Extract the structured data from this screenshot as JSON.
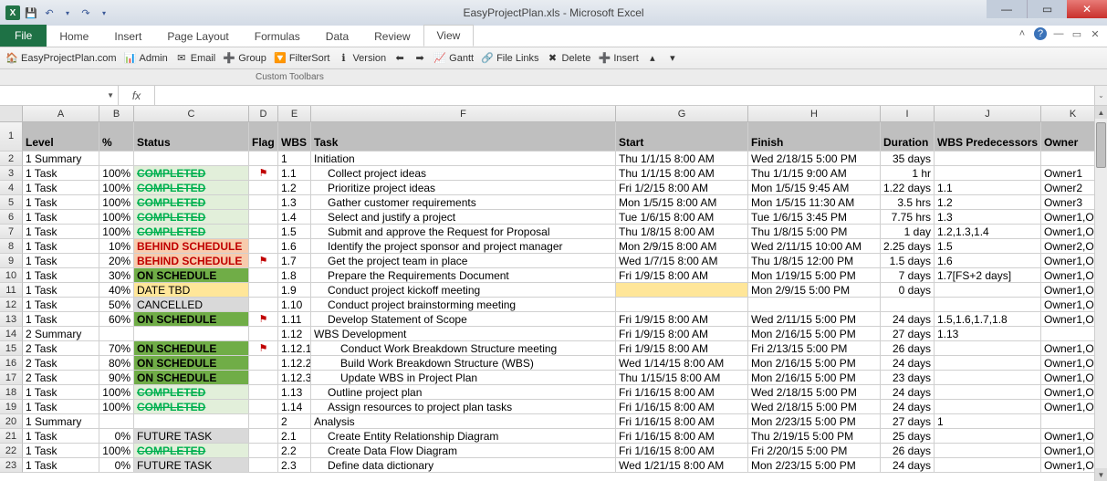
{
  "window": {
    "title": "EasyProjectPlan.xls   -  Microsoft Excel",
    "qat": {
      "undo": "↶",
      "redo": "↷",
      "dropdown": "▾"
    }
  },
  "ribbon": {
    "tabs": [
      "File",
      "Home",
      "Insert",
      "Page Layout",
      "Formulas",
      "Data",
      "Review",
      "View"
    ],
    "help_tip": "?"
  },
  "toolbar": {
    "items": [
      {
        "icon": "🏠",
        "label": "EasyProjectPlan.com"
      },
      {
        "icon": "📊",
        "label": "Admin"
      },
      {
        "icon": "✉",
        "label": "Email"
      },
      {
        "icon": "➕",
        "label": "Group"
      },
      {
        "icon": "🔽",
        "label": "FilterSort"
      },
      {
        "icon": "ℹ",
        "label": "Version"
      },
      {
        "icon": "⬅",
        "label": ""
      },
      {
        "icon": "➡",
        "label": ""
      },
      {
        "icon": "📈",
        "label": "Gantt"
      },
      {
        "icon": "🔗",
        "label": "File Links"
      },
      {
        "icon": "✖",
        "label": "Delete"
      },
      {
        "icon": "➕",
        "label": "Insert"
      },
      {
        "icon": "▴",
        "label": ""
      },
      {
        "icon": "▾",
        "label": ""
      }
    ],
    "group_label": "Custom Toolbars"
  },
  "formula_bar": {
    "name_box": "",
    "fx": "fx",
    "value": ""
  },
  "columns": [
    "",
    "A",
    "B",
    "C",
    "D",
    "E",
    "F",
    "G",
    "H",
    "I",
    "J",
    "K"
  ],
  "headers": {
    "level": "Level",
    "pct": "%",
    "status": "Status",
    "flag": "Flag",
    "wbs": "WBS",
    "task": "Task",
    "start": "Start",
    "finish": "Finish",
    "duration": "Duration",
    "pred": "WBS Predecessors",
    "owner": "Owner"
  },
  "rows": [
    {
      "n": 2,
      "type": "sum1",
      "level": "1 Summary",
      "pct": "",
      "status": "",
      "flag": "",
      "wbs": "1",
      "task": "Initiation",
      "start": "Thu 1/1/15 8:00 AM",
      "finish": "Wed 2/18/15 5:00 PM",
      "dur": "35 days",
      "pred": "",
      "owner": ""
    },
    {
      "n": 3,
      "type": "task",
      "level": "1 Task",
      "pct": "100%",
      "status": "COMPLETED",
      "sclass": "completed",
      "flag": "⚑",
      "wbs": "1.1",
      "task": "Collect project ideas",
      "ind": 1,
      "start": "Thu 1/1/15 8:00 AM",
      "finish": "Thu 1/1/15 9:00 AM",
      "dur": "1 hr",
      "pred": "",
      "owner": "Owner1"
    },
    {
      "n": 4,
      "type": "task",
      "level": "1 Task",
      "pct": "100%",
      "status": "COMPLETED",
      "sclass": "completed",
      "flag": "",
      "wbs": "1.2",
      "task": "Prioritize project ideas",
      "ind": 1,
      "start": "Fri 1/2/15 8:00 AM",
      "finish": "Mon 1/5/15 9:45 AM",
      "dur": "1.22 days",
      "pred": "1.1",
      "owner": "Owner2"
    },
    {
      "n": 5,
      "type": "task",
      "level": "1 Task",
      "pct": "100%",
      "status": "COMPLETED",
      "sclass": "completed",
      "flag": "",
      "wbs": "1.3",
      "task": "Gather customer requirements",
      "ind": 1,
      "start": "Mon 1/5/15 8:00 AM",
      "finish": "Mon 1/5/15 11:30 AM",
      "dur": "3.5 hrs",
      "pred": "1.2",
      "owner": "Owner3"
    },
    {
      "n": 6,
      "type": "task",
      "level": "1 Task",
      "pct": "100%",
      "status": "COMPLETED",
      "sclass": "completed",
      "flag": "",
      "wbs": "1.4",
      "task": "Select and justify a project",
      "ind": 1,
      "start": "Tue 1/6/15 8:00 AM",
      "finish": "Tue 1/6/15 3:45 PM",
      "dur": "7.75 hrs",
      "pred": "1.3",
      "owner": "Owner1,O"
    },
    {
      "n": 7,
      "type": "task",
      "level": "1 Task",
      "pct": "100%",
      "status": "COMPLETED",
      "sclass": "completed",
      "flag": "",
      "wbs": "1.5",
      "task": "Submit and approve the Request for Proposal",
      "ind": 1,
      "start": "Thu 1/8/15 8:00 AM",
      "finish": "Thu 1/8/15 5:00 PM",
      "dur": "1 day",
      "pred": "1.2,1.3,1.4",
      "owner": "Owner1,O"
    },
    {
      "n": 8,
      "type": "task",
      "level": "1 Task",
      "pct": "10%",
      "status": "BEHIND SCHEDULE",
      "sclass": "behind",
      "flag": "",
      "wbs": "1.6",
      "task": "Identify the project sponsor and project manager",
      "ind": 1,
      "start": "Mon 2/9/15 8:00 AM",
      "finish": "Wed 2/11/15 10:00 AM",
      "dur": "2.25 days",
      "pred": "1.5",
      "owner": "Owner2,O"
    },
    {
      "n": 9,
      "type": "task",
      "level": "1 Task",
      "pct": "20%",
      "status": "BEHIND SCHEDULE",
      "sclass": "behind",
      "flag": "⚑",
      "wbs": "1.7",
      "task": "Get the project team in place",
      "ind": 1,
      "start": "Wed 1/7/15 8:00 AM",
      "finish": "Thu 1/8/15 12:00 PM",
      "dur": "1.5 days",
      "pred": "1.6",
      "owner": "Owner1,O"
    },
    {
      "n": 10,
      "type": "task",
      "level": "1 Task",
      "pct": "30%",
      "status": "ON SCHEDULE",
      "sclass": "onsched",
      "flag": "",
      "wbs": "1.8",
      "task": "Prepare the Requirements Document",
      "ind": 1,
      "start": "Fri 1/9/15 8:00 AM",
      "finish": "Mon 1/19/15 5:00 PM",
      "dur": "7 days",
      "pred": "1.7[FS+2 days]",
      "owner": "Owner1,O"
    },
    {
      "n": 11,
      "type": "task",
      "level": "1 Task",
      "pct": "40%",
      "status": "DATE TBD",
      "sclass": "datetbd",
      "flag": "",
      "wbs": "1.9",
      "task": "Conduct project kickoff meeting",
      "ind": 1,
      "start": "",
      "start_tbd": true,
      "finish": "Mon 2/9/15 5:00 PM",
      "dur": "0 days",
      "pred": "",
      "owner": "Owner1,O"
    },
    {
      "n": 12,
      "type": "task",
      "level": "1 Task",
      "pct": "50%",
      "status": "CANCELLED",
      "sclass": "cancelled",
      "flag": "",
      "wbs": "1.10",
      "task": "Conduct project brainstorming meeting",
      "ind": 1,
      "start": "",
      "finish": "",
      "dur": "",
      "pred": "",
      "owner": "Owner1,O"
    },
    {
      "n": 13,
      "type": "task",
      "level": "1 Task",
      "pct": "60%",
      "status": "ON SCHEDULE",
      "sclass": "onsched",
      "flag": "⚑",
      "wbs": "1.11",
      "task": "Develop Statement of Scope",
      "ind": 1,
      "start": "Fri 1/9/15 8:00 AM",
      "finish": "Wed 2/11/15 5:00 PM",
      "dur": "24 days",
      "pred": "1.5,1.6,1.7,1.8",
      "owner": "Owner1,O"
    },
    {
      "n": 14,
      "type": "sum2",
      "level": "2 Summary",
      "pct": "",
      "status": "",
      "flag": "",
      "wbs": "1.12",
      "task": "WBS Development",
      "start": "Fri 1/9/15 8:00 AM",
      "finish": "Mon 2/16/15 5:00 PM",
      "dur": "27 days",
      "pred": "1.13",
      "owner": ""
    },
    {
      "n": 15,
      "type": "task",
      "level": "2 Task",
      "pct": "70%",
      "status": "ON SCHEDULE",
      "sclass": "onsched",
      "flag": "⚑",
      "wbs": "1.12.1",
      "task": "Conduct Work Breakdown Structure meeting",
      "ind": 2,
      "start": "Fri 1/9/15 8:00 AM",
      "finish": "Fri 2/13/15 5:00 PM",
      "dur": "26 days",
      "pred": "",
      "owner": "Owner1,O"
    },
    {
      "n": 16,
      "type": "task",
      "level": "2 Task",
      "pct": "80%",
      "status": "ON SCHEDULE",
      "sclass": "onsched",
      "flag": "",
      "wbs": "1.12.2",
      "task": "Build Work Breakdown Structure (WBS)",
      "ind": 2,
      "start": "Wed 1/14/15 8:00 AM",
      "finish": "Mon 2/16/15 5:00 PM",
      "dur": "24 days",
      "pred": "",
      "owner": "Owner1,O"
    },
    {
      "n": 17,
      "type": "task",
      "level": "2 Task",
      "pct": "90%",
      "status": "ON SCHEDULE",
      "sclass": "onsched",
      "flag": "",
      "wbs": "1.12.3",
      "task": "Update WBS in Project Plan",
      "ind": 2,
      "start": "Thu 1/15/15 8:00 AM",
      "finish": "Mon 2/16/15 5:00 PM",
      "dur": "23 days",
      "pred": "",
      "owner": "Owner1,O"
    },
    {
      "n": 18,
      "type": "task",
      "level": "1 Task",
      "pct": "100%",
      "status": "COMPLETED",
      "sclass": "completed",
      "flag": "",
      "wbs": "1.13",
      "task": "Outline project plan",
      "ind": 1,
      "start": "Fri 1/16/15 8:00 AM",
      "finish": "Wed 2/18/15 5:00 PM",
      "dur": "24 days",
      "pred": "",
      "owner": "Owner1,O"
    },
    {
      "n": 19,
      "type": "task",
      "level": "1 Task",
      "pct": "100%",
      "status": "COMPLETED",
      "sclass": "completed",
      "flag": "",
      "wbs": "1.14",
      "task": "Assign resources to project plan tasks",
      "ind": 1,
      "start": "Fri 1/16/15 8:00 AM",
      "finish": "Wed 2/18/15 5:00 PM",
      "dur": "24 days",
      "pred": "",
      "owner": "Owner1,O"
    },
    {
      "n": 20,
      "type": "sum1",
      "level": "1 Summary",
      "pct": "",
      "status": "",
      "flag": "",
      "wbs": "2",
      "task": "Analysis",
      "start": "Fri 1/16/15 8:00 AM",
      "finish": "Mon 2/23/15 5:00 PM",
      "dur": "27 days",
      "pred": "1",
      "owner": ""
    },
    {
      "n": 21,
      "type": "task",
      "level": "1 Task",
      "pct": "0%",
      "status": "FUTURE TASK",
      "sclass": "future",
      "flag": "",
      "wbs": "2.1",
      "task": "Create Entity Relationship Diagram",
      "ind": 1,
      "start": "Fri 1/16/15 8:00 AM",
      "finish": "Thu 2/19/15 5:00 PM",
      "dur": "25 days",
      "pred": "",
      "owner": "Owner1,O"
    },
    {
      "n": 22,
      "type": "task",
      "level": "1 Task",
      "pct": "100%",
      "status": "COMPLETED",
      "sclass": "completed",
      "flag": "",
      "wbs": "2.2",
      "task": "Create Data Flow Diagram",
      "ind": 1,
      "start": "Fri 1/16/15 8:00 AM",
      "finish": "Fri 2/20/15 5:00 PM",
      "dur": "26 days",
      "pred": "",
      "owner": "Owner1,O"
    },
    {
      "n": 23,
      "type": "task",
      "level": "1 Task",
      "pct": "0%",
      "status": "FUTURE TASK",
      "sclass": "future",
      "flag": "",
      "wbs": "2.3",
      "task": "Define data dictionary",
      "ind": 1,
      "start": "Wed 1/21/15 8:00 AM",
      "finish": "Mon 2/23/15 5:00 PM",
      "dur": "24 days",
      "pred": "",
      "owner": "Owner1,O"
    }
  ]
}
